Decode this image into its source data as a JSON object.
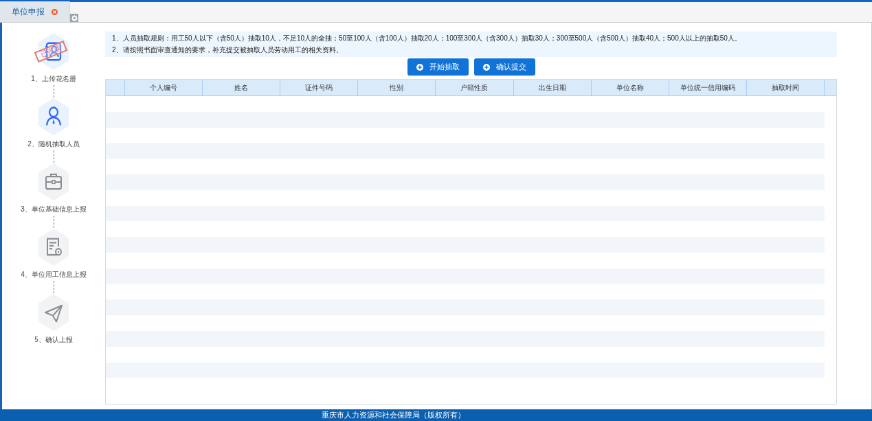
{
  "tabs": [
    {
      "label": "单位申报",
      "selected": true
    }
  ],
  "steps": [
    {
      "label": "1、上传花名册",
      "kind": "roster",
      "completed": true,
      "active": false,
      "stamp": "已完成"
    },
    {
      "label": "2、随机抽取人员",
      "kind": "person",
      "completed": false,
      "active": true
    },
    {
      "label": "3、单位基础信息上报",
      "kind": "briefcase",
      "completed": false,
      "active": false
    },
    {
      "label": "4、单位用工信息上报",
      "kind": "document",
      "completed": false,
      "active": false
    },
    {
      "label": "5、确认上报",
      "kind": "plane",
      "completed": false,
      "active": false
    }
  ],
  "notice": [
    "1、人员抽取规则：用工50人以下（含50人）抽取10人，不足10人的全抽；50至100人（含100人）抽取20人；100至300人（含300人）抽取30人；300至500人（含500人）抽取40人；500人以上的抽取50人。",
    "2、请按照书面审查通知的要求，补充提交被抽取人员劳动用工的相关资料。"
  ],
  "buttons": [
    "开始抽取",
    "确认提交"
  ],
  "table": {
    "columns": [
      "个人编号",
      "姓名",
      "证件号码",
      "性别",
      "户籍性质",
      "出生日期",
      "单位名称",
      "单位统一信用编码",
      "抽取时间"
    ]
  },
  "footer": "重庆市人力资源和社会保障局（版权所有）"
}
